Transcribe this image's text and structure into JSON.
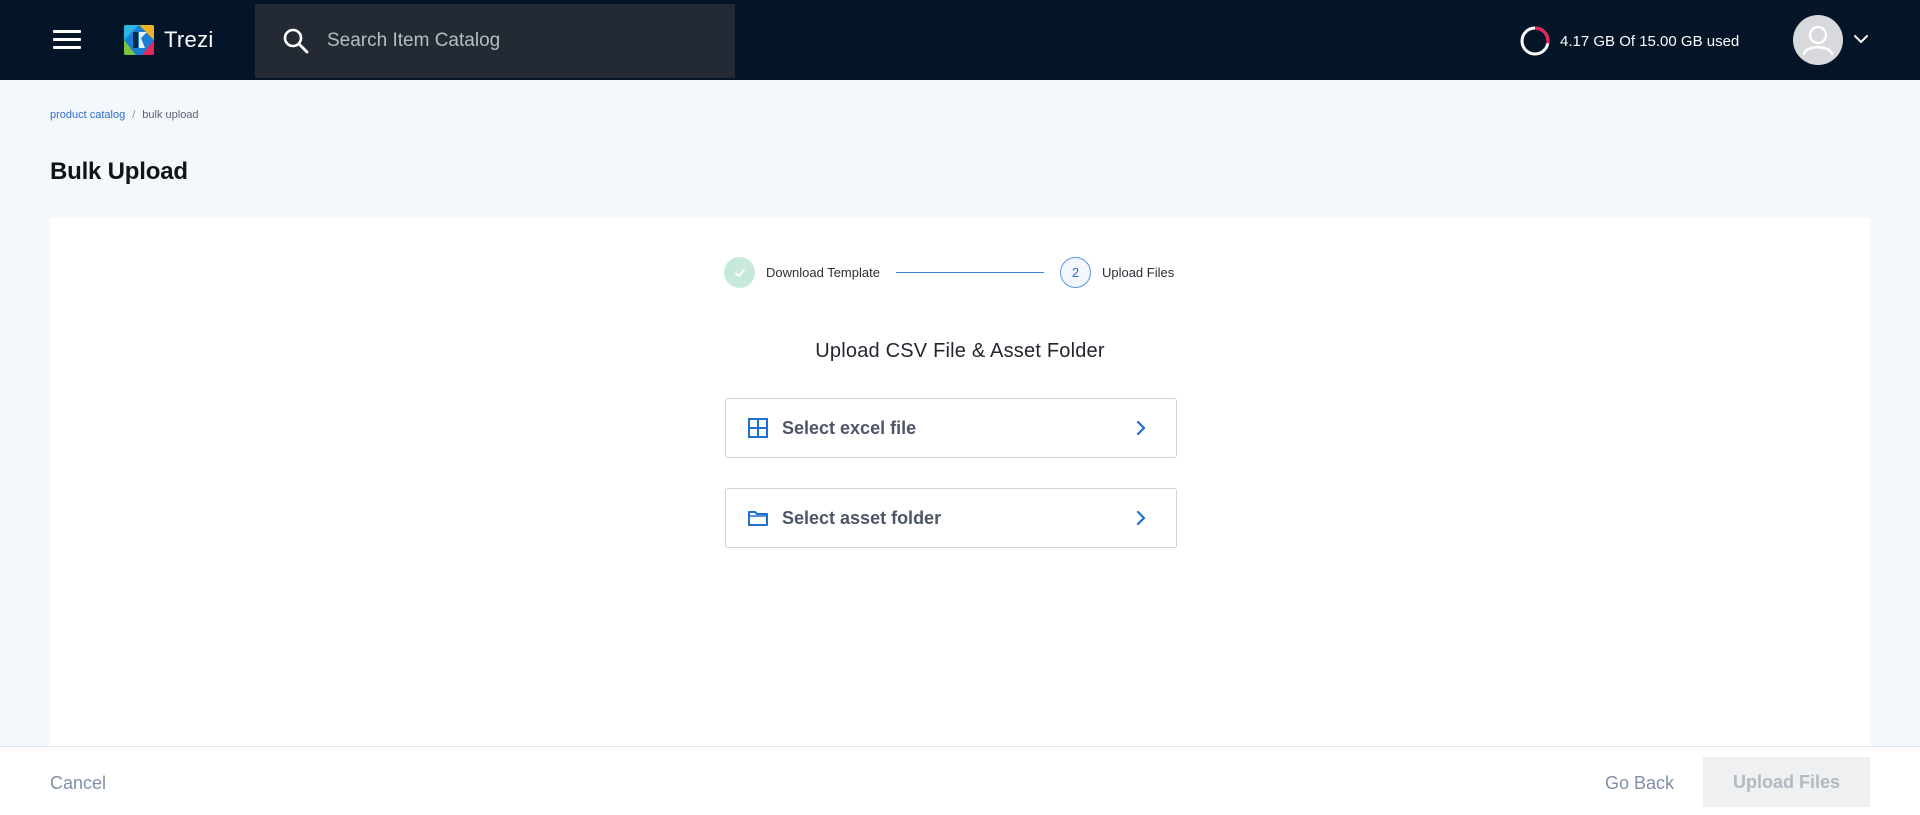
{
  "app": {
    "name": "Trezi"
  },
  "search": {
    "placeholder": "Search Item Catalog",
    "value": ""
  },
  "storage": {
    "label": "4.17 GB Of 15.00 GB used",
    "used_fraction": 0.278
  },
  "breadcrumb": {
    "parent": "product catalog",
    "separator": "/",
    "current": "bulk upload"
  },
  "page": {
    "title": "Bulk Upload"
  },
  "stepper": {
    "steps": [
      {
        "label": "Download Template",
        "status": "complete"
      },
      {
        "number": "2",
        "label": "Upload Files",
        "status": "current"
      }
    ]
  },
  "upload": {
    "title": "Upload CSV File & Asset Folder",
    "excel_label": "Select excel file",
    "folder_label": "Select asset folder"
  },
  "footer": {
    "cancel": "Cancel",
    "go_back": "Go Back",
    "upload": "Upload Files"
  },
  "icons": {
    "menu": "hamburger-menu-icon",
    "search": "search-icon",
    "storage": "storage-ring-icon",
    "avatar": "user-avatar-icon",
    "caret": "chevron-down-icon",
    "step_done": "check-icon",
    "excel": "grid-icon",
    "folder": "folder-icon",
    "chevron": "chevron-right-icon"
  },
  "colors": {
    "header_bg": "#031527",
    "search_bg": "#242a33",
    "page_bg": "#f3f8fc",
    "accent": "#2f6fcf",
    "step_done": "#c6ead7",
    "storage_arc": "#e8245c",
    "disabled_bg": "#eef0f2"
  }
}
